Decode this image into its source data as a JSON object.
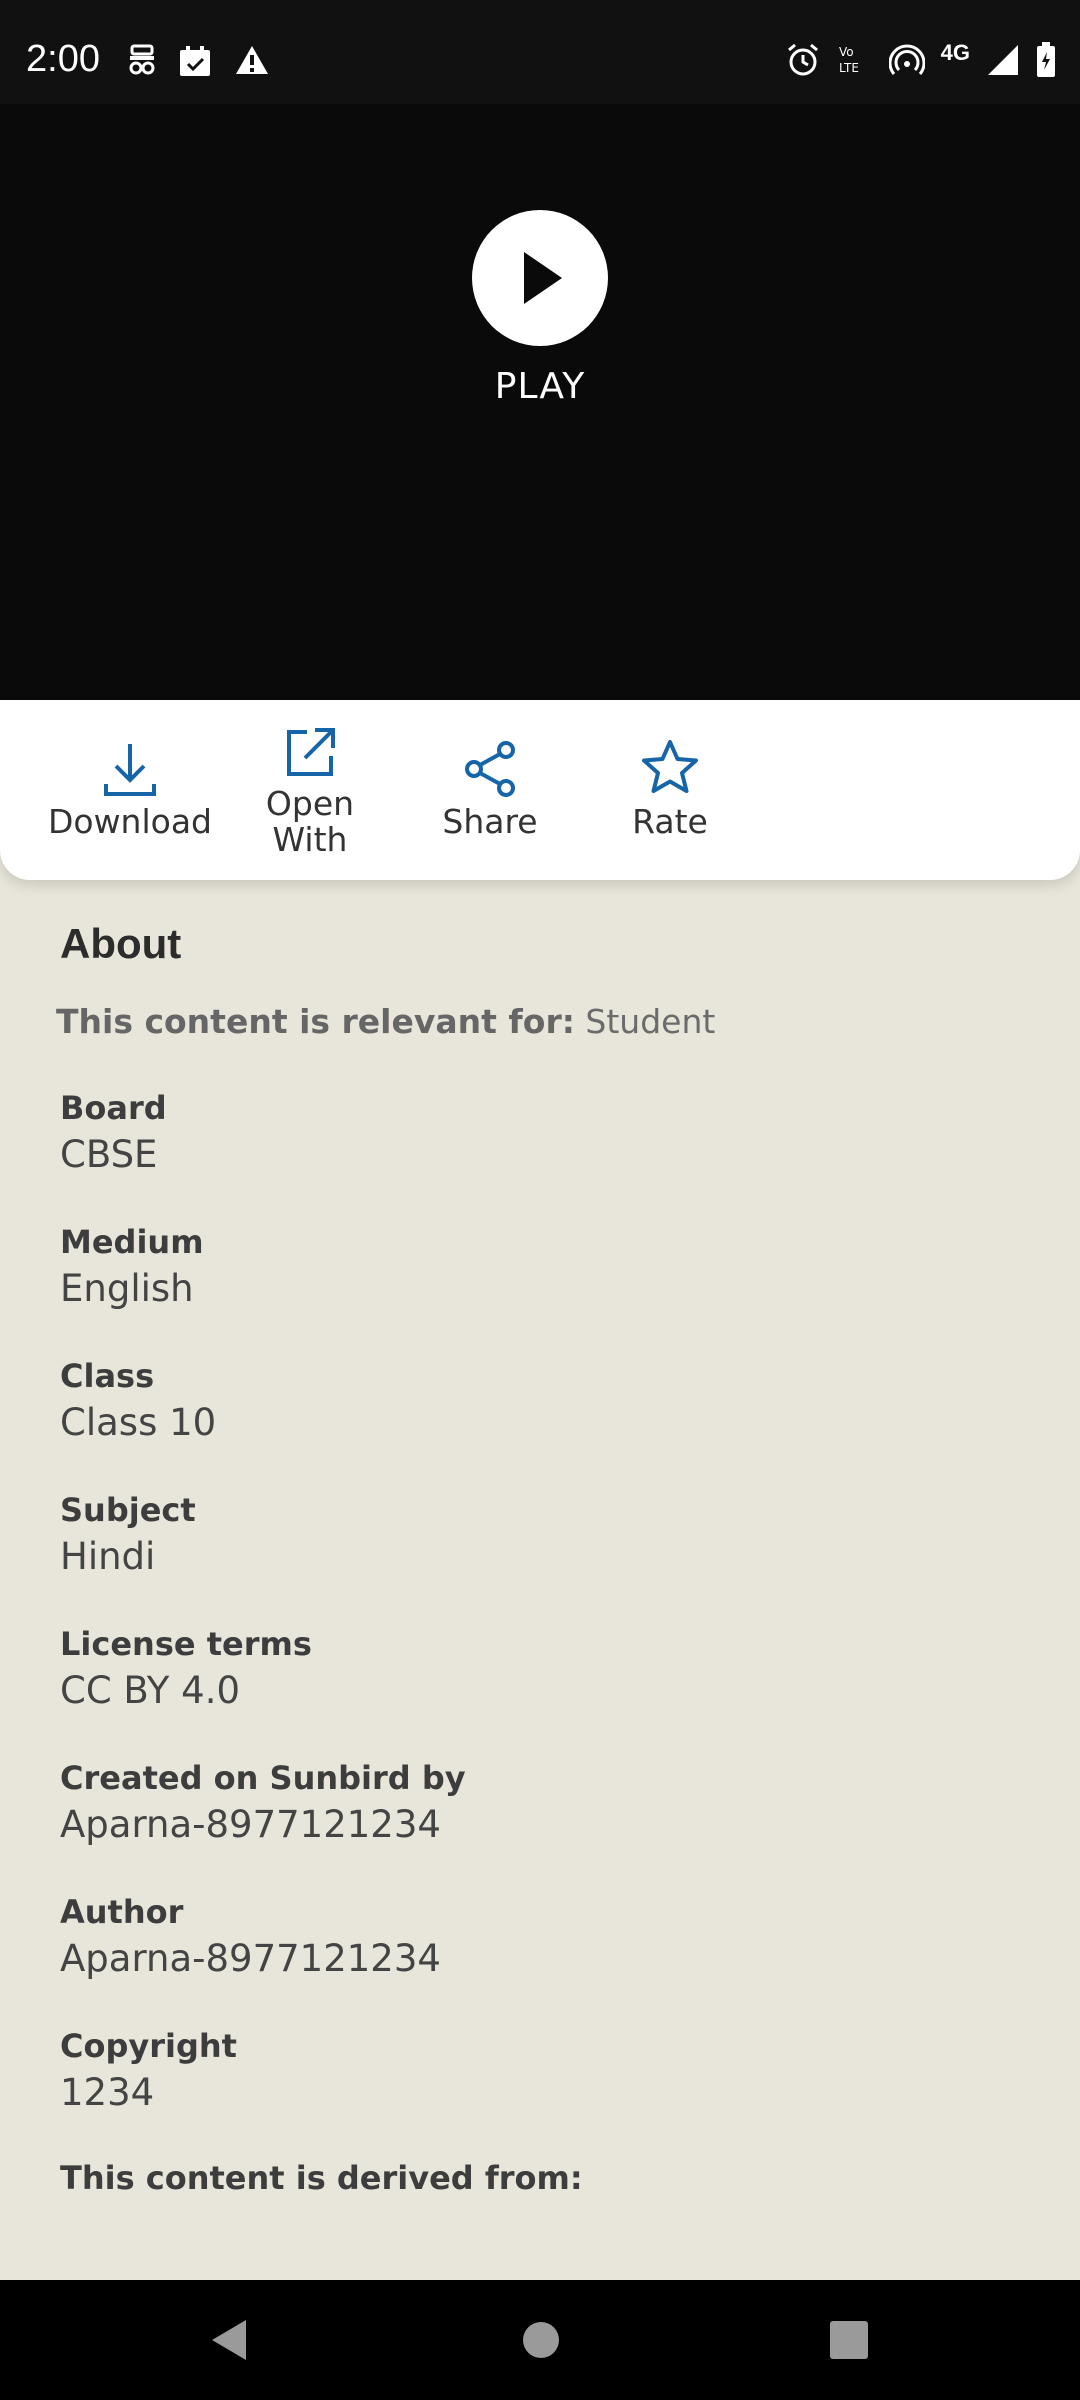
{
  "status_bar": {
    "time": "2:00",
    "network_label": "4G",
    "left_icons": [
      "incognito-icon",
      "calendar-icon",
      "warning-icon"
    ],
    "right_icons": [
      "alarm-icon",
      "volte-icon",
      "hotspot-icon",
      "signal-icon",
      "battery-icon"
    ]
  },
  "player": {
    "play_label": "PLAY"
  },
  "actions": [
    {
      "label": "Download",
      "icon": "download-icon"
    },
    {
      "label": "Open\nWith",
      "icon": "open-external-icon"
    },
    {
      "label": "Share",
      "icon": "share-icon"
    },
    {
      "label": "Rate",
      "icon": "star-icon"
    }
  ],
  "about": {
    "title": "About",
    "relevant_prefix": "This content is relevant for:",
    "relevant_value": "Student",
    "fields": [
      {
        "label": "Board",
        "value": "CBSE"
      },
      {
        "label": "Medium",
        "value": "English"
      },
      {
        "label": "Class",
        "value": "Class 10"
      },
      {
        "label": "Subject",
        "value": "Hindi"
      },
      {
        "label": "License terms",
        "value": "CC BY 4.0"
      },
      {
        "label": "Created on Sunbird by",
        "value": "Aparna-8977121234"
      },
      {
        "label": "Author",
        "value": "Aparna-8977121234"
      },
      {
        "label": "Copyright",
        "value": "1234"
      }
    ],
    "derived_label": "This content is derived from:"
  },
  "colors": {
    "accent": "#1565a8",
    "page_background": "#e8e6da",
    "video_background": "#0a0a0b"
  }
}
